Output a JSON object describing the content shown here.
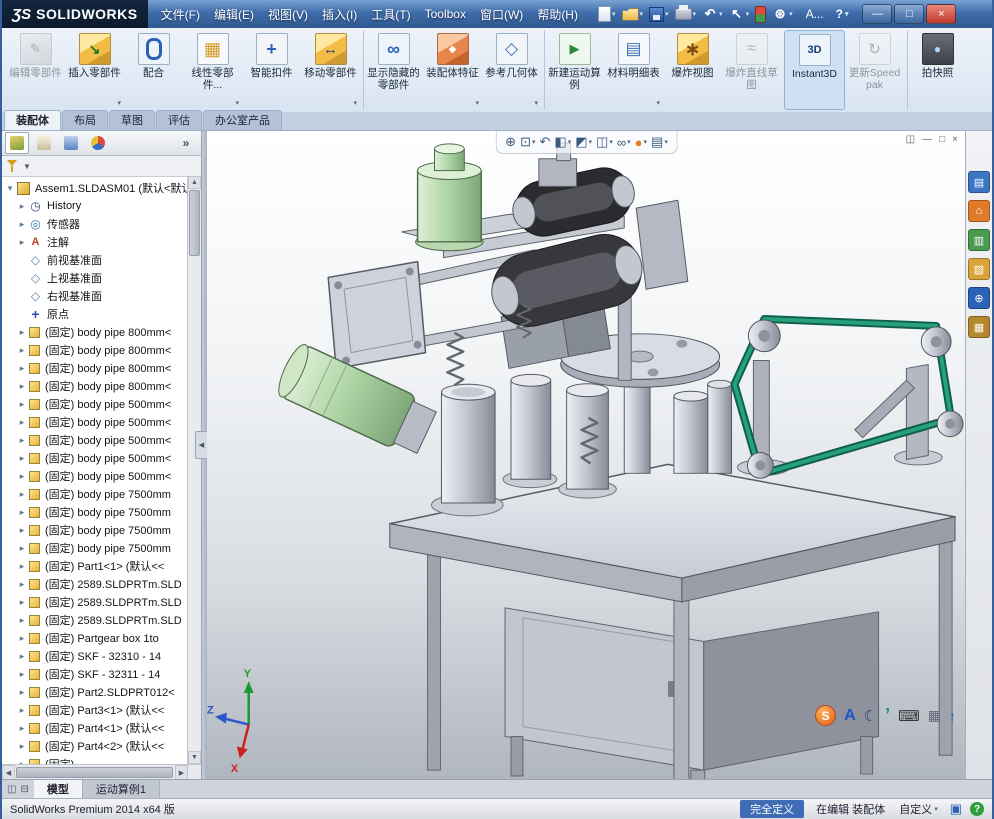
{
  "colors": {
    "titlebar_blue": "#3f6dab",
    "ribbon_bg": "#dfe9f5",
    "belt_teal": "#27a07f",
    "motor_green": "#abd2a2",
    "status_defined_blue": "#3f6db5"
  },
  "window": {
    "logo_mark": "ƷS",
    "logo_text": "SOLIDWORKS",
    "title_doc_truncated": "A...",
    "help_icon_label": "?",
    "menus": [
      {
        "label": "文件(F)"
      },
      {
        "label": "编辑(E)"
      },
      {
        "label": "视图(V)"
      },
      {
        "label": "插入(I)"
      },
      {
        "label": "工具(T)"
      },
      {
        "label": "Toolbox"
      },
      {
        "label": "窗口(W)"
      },
      {
        "label": "帮助(H)"
      }
    ],
    "quick_icons": [
      {
        "name": "new-document-icon",
        "cls": "qi-new",
        "caret": true
      },
      {
        "name": "open-icon",
        "cls": "qi-open",
        "caret": true
      },
      {
        "name": "save-icon",
        "cls": "qi-save",
        "caret": true
      },
      {
        "name": "print-icon",
        "cls": "qi-print",
        "caret": true
      },
      {
        "name": "undo-icon",
        "cls": "qi-undo",
        "glyph": "↶",
        "caret": true
      },
      {
        "name": "select-icon",
        "cls": "qi-select",
        "glyph": "↖",
        "caret": true
      },
      {
        "name": "rebuild-icon",
        "cls": "qi-rebuild"
      },
      {
        "name": "options-gear-icon",
        "cls": "qi-gear",
        "glyph": "⊛",
        "caret": true
      }
    ],
    "window_buttons": [
      {
        "name": "minimize-button",
        "cls": "wb-min",
        "glyph": "—"
      },
      {
        "name": "maximize-button",
        "cls": "wb-max",
        "glyph": "□"
      },
      {
        "name": "close-button",
        "cls": "wb-close",
        "glyph": "×"
      }
    ]
  },
  "ribbon": {
    "buttons": [
      {
        "label": "编辑零部件",
        "icon": "icon-edit-component",
        "disabled": true
      },
      {
        "label": "插入零部件",
        "icon": "icon-insert-component",
        "caret": true
      },
      {
        "label": "配合",
        "icon": "icon-mate"
      },
      {
        "label": "线性零部件...",
        "icon": "icon-linear-pattern",
        "caret": true
      },
      {
        "label": "智能扣件",
        "icon": "icon-smart-fasteners"
      },
      {
        "label": "移动零部件",
        "icon": "icon-move-component",
        "caret": true
      },
      {
        "label": "显示隐藏的零部件",
        "icon": "icon-show-hidden",
        "sep": true
      },
      {
        "label": "装配体特征",
        "icon": "icon-assembly-features",
        "caret": true
      },
      {
        "label": "参考几何体",
        "icon": "icon-reference-geometry",
        "caret": true
      },
      {
        "label": "新建运动算例",
        "icon": "icon-motion-study",
        "sep": true
      },
      {
        "label": "材料明细表",
        "icon": "icon-bom",
        "caret": true
      },
      {
        "label": "爆炸视图",
        "icon": "icon-exploded-view"
      },
      {
        "label": "爆炸直线草图",
        "icon": "icon-explode-sketch",
        "disabled": true
      },
      {
        "label": "Instant3D",
        "icon": "icon-instant3d",
        "sep": true,
        "active": true
      },
      {
        "label": "更新Speedpak",
        "icon": "icon-speedpak",
        "disabled": true
      },
      {
        "label": "拍快照",
        "icon": "icon-snapshot",
        "sep": true
      }
    ]
  },
  "command_tabs": {
    "tabs": [
      {
        "label": "装配体",
        "active": true
      },
      {
        "label": "布局"
      },
      {
        "label": "草图"
      },
      {
        "label": "评估"
      },
      {
        "label": "办公室产品"
      }
    ]
  },
  "headsup": {
    "icons": [
      {
        "name": "zoom-fit-icon",
        "glyph": "⊕"
      },
      {
        "name": "zoom-area-icon",
        "glyph": "⊡",
        "caret": true
      },
      {
        "name": "previous-view-icon",
        "glyph": "↶"
      },
      {
        "name": "section-view-icon",
        "glyph": "◧",
        "caret": true
      },
      {
        "name": "view-orientation-icon",
        "glyph": "◩",
        "caret": true
      },
      {
        "name": "display-style-icon",
        "glyph": "◫",
        "caret": true
      },
      {
        "name": "hide-show-items-icon",
        "glyph": "∞",
        "caret": true
      },
      {
        "name": "edit-appearance-icon",
        "glyph": "●",
        "cls": "hud-ball",
        "caret": true
      },
      {
        "name": "apply-scene-icon",
        "glyph": "▤",
        "caret": true
      }
    ]
  },
  "doc_controls": [
    {
      "name": "doc-new-window-icon",
      "glyph": "◫"
    },
    {
      "name": "doc-minimize-icon",
      "glyph": "—"
    },
    {
      "name": "doc-restore-icon",
      "glyph": "□"
    },
    {
      "name": "doc-close-icon",
      "glyph": "×"
    }
  ],
  "panel": {
    "tabs": [
      {
        "name": "featuremanager-tab",
        "cls": "pt-tree",
        "active": true
      },
      {
        "name": "propertymanager-tab",
        "cls": "pt-prop"
      },
      {
        "name": "configurationmanager-tab",
        "cls": "pt-config"
      },
      {
        "name": "displaymanager-tab",
        "cls": "pt-display"
      },
      {
        "name": "panel-expand-chevron",
        "cls": "pt-more",
        "glyph": "»"
      }
    ],
    "filter_caret": "▼",
    "tree": {
      "items": [
        {
          "e": "▾",
          "icon": "icon-asm",
          "label": "Assem1.SLDASM01 (默认<默认..",
          "root": true
        },
        {
          "e": "▸",
          "icon": "icon-history",
          "label": "History"
        },
        {
          "e": "▸",
          "icon": "icon-sensor",
          "label": "传感器"
        },
        {
          "e": "▸",
          "icon": "icon-annot",
          "label": "注解"
        },
        {
          "e": "",
          "icon": "icon-plane",
          "label": "前视基准面"
        },
        {
          "e": "",
          "icon": "icon-plane",
          "label": "上视基准面"
        },
        {
          "e": "",
          "icon": "icon-plane",
          "label": "右视基准面"
        },
        {
          "e": "",
          "icon": "icon-origin",
          "label": "原点"
        },
        {
          "e": "▸",
          "icon": "icon-part",
          "label": "(固定) body pipe 800mm<"
        },
        {
          "e": "▸",
          "icon": "icon-part",
          "label": "(固定) body pipe 800mm<"
        },
        {
          "e": "▸",
          "icon": "icon-part",
          "label": "(固定) body pipe 800mm<"
        },
        {
          "e": "▸",
          "icon": "icon-part",
          "label": "(固定) body pipe 800mm<"
        },
        {
          "e": "▸",
          "icon": "icon-part",
          "label": "(固定) body pipe 500mm<"
        },
        {
          "e": "▸",
          "icon": "icon-part",
          "label": "(固定) body pipe 500mm<"
        },
        {
          "e": "▸",
          "icon": "icon-part",
          "label": "(固定) body pipe 500mm<"
        },
        {
          "e": "▸",
          "icon": "icon-part",
          "label": "(固定) body pipe 500mm<"
        },
        {
          "e": "▸",
          "icon": "icon-part",
          "label": "(固定) body pipe 500mm<"
        },
        {
          "e": "▸",
          "icon": "icon-part",
          "label": "(固定) body pipe 7500mm"
        },
        {
          "e": "▸",
          "icon": "icon-part",
          "label": "(固定) body pipe 7500mm"
        },
        {
          "e": "▸",
          "icon": "icon-part",
          "label": "(固定) body pipe 7500mm"
        },
        {
          "e": "▸",
          "icon": "icon-part",
          "label": "(固定) body pipe 7500mm"
        },
        {
          "e": "▸",
          "icon": "icon-part",
          "label": "(固定) Part1<1> (默认<<"
        },
        {
          "e": "▸",
          "icon": "icon-part",
          "label": "(固定) 2589.SLDPRTm.SLD"
        },
        {
          "e": "▸",
          "icon": "icon-part",
          "label": "(固定) 2589.SLDPRTm.SLD"
        },
        {
          "e": "▸",
          "icon": "icon-part",
          "label": "(固定) 2589.SLDPRTm.SLD"
        },
        {
          "e": "▸",
          "icon": "icon-part",
          "label": "(固定) Partgear box 1to"
        },
        {
          "e": "▸",
          "icon": "icon-part",
          "label": "(固定) SKF - 32310 - 14"
        },
        {
          "e": "▸",
          "icon": "icon-part",
          "label": "(固定) SKF - 32311 - 14"
        },
        {
          "e": "▸",
          "icon": "icon-part",
          "label": "(固定) Part2.SLDPRT012<"
        },
        {
          "e": "▸",
          "icon": "icon-part",
          "label": "(固定) Part3<1> (默认<<"
        },
        {
          "e": "▸",
          "icon": "icon-part",
          "label": "(固定) Part4<1> (默认<<"
        },
        {
          "e": "▸",
          "icon": "icon-part",
          "label": "(固定) Part4<2> (默认<<"
        },
        {
          "e": "▸",
          "icon": "icon-part",
          "label": "(固定)"
        }
      ]
    }
  },
  "taskpane": {
    "icons": [
      {
        "name": "resources-tab",
        "cls": "tp-blue",
        "glyph": "▤"
      },
      {
        "name": "design-library-tab",
        "cls": "tp-orange",
        "glyph": "⌂"
      },
      {
        "name": "file-explorer-tab",
        "cls": "tp-green",
        "glyph": "▥"
      },
      {
        "name": "view-palette-tab",
        "cls": "tp-gold",
        "glyph": "▧"
      },
      {
        "name": "appearances-tab",
        "cls": "tp-globe",
        "glyph": "⊕"
      },
      {
        "name": "custom-properties-tab",
        "cls": "tp-brown",
        "glyph": "▦"
      }
    ]
  },
  "float_toolbar": {
    "icons": [
      {
        "name": "solidworks-launcher-icon",
        "cls": "fb-s",
        "glyph": "S"
      },
      {
        "name": "text-tool-icon",
        "cls": "fb-a",
        "glyph": "A"
      },
      {
        "name": "moon-icon",
        "cls": "fb-moon",
        "glyph": "☾"
      },
      {
        "name": "quote-icon",
        "cls": "fb-quote",
        "glyph": "’"
      },
      {
        "name": "keyboard-icon",
        "cls": "fb-kb",
        "glyph": "⌨"
      },
      {
        "name": "grid-icon",
        "cls": "fb-grid",
        "glyph": "▦"
      },
      {
        "name": "upload-icon",
        "cls": "fb-up",
        "glyph": "↑"
      }
    ]
  },
  "viewport": {
    "triad": {
      "x": "X",
      "y": "Y",
      "z": "Z"
    }
  },
  "model_tabs": {
    "icons": [
      {
        "name": "split-view-icon",
        "glyph": "◫"
      },
      {
        "name": "split-horizontal-icon",
        "glyph": "⊟"
      }
    ],
    "tabs": [
      {
        "label": "模型",
        "active": true
      },
      {
        "label": "运动算例1"
      }
    ]
  },
  "statusbar": {
    "left": "SolidWorks Premium 2014 x64 版",
    "define_state": "完全定义",
    "editing": "在编辑 装配体",
    "custom": "自定义",
    "icons": [
      {
        "name": "status-tag-icon",
        "cls": "sb-blue",
        "glyph": "▣"
      },
      {
        "name": "status-help-icon",
        "cls": "sb-help",
        "glyph": "?"
      }
    ]
  }
}
